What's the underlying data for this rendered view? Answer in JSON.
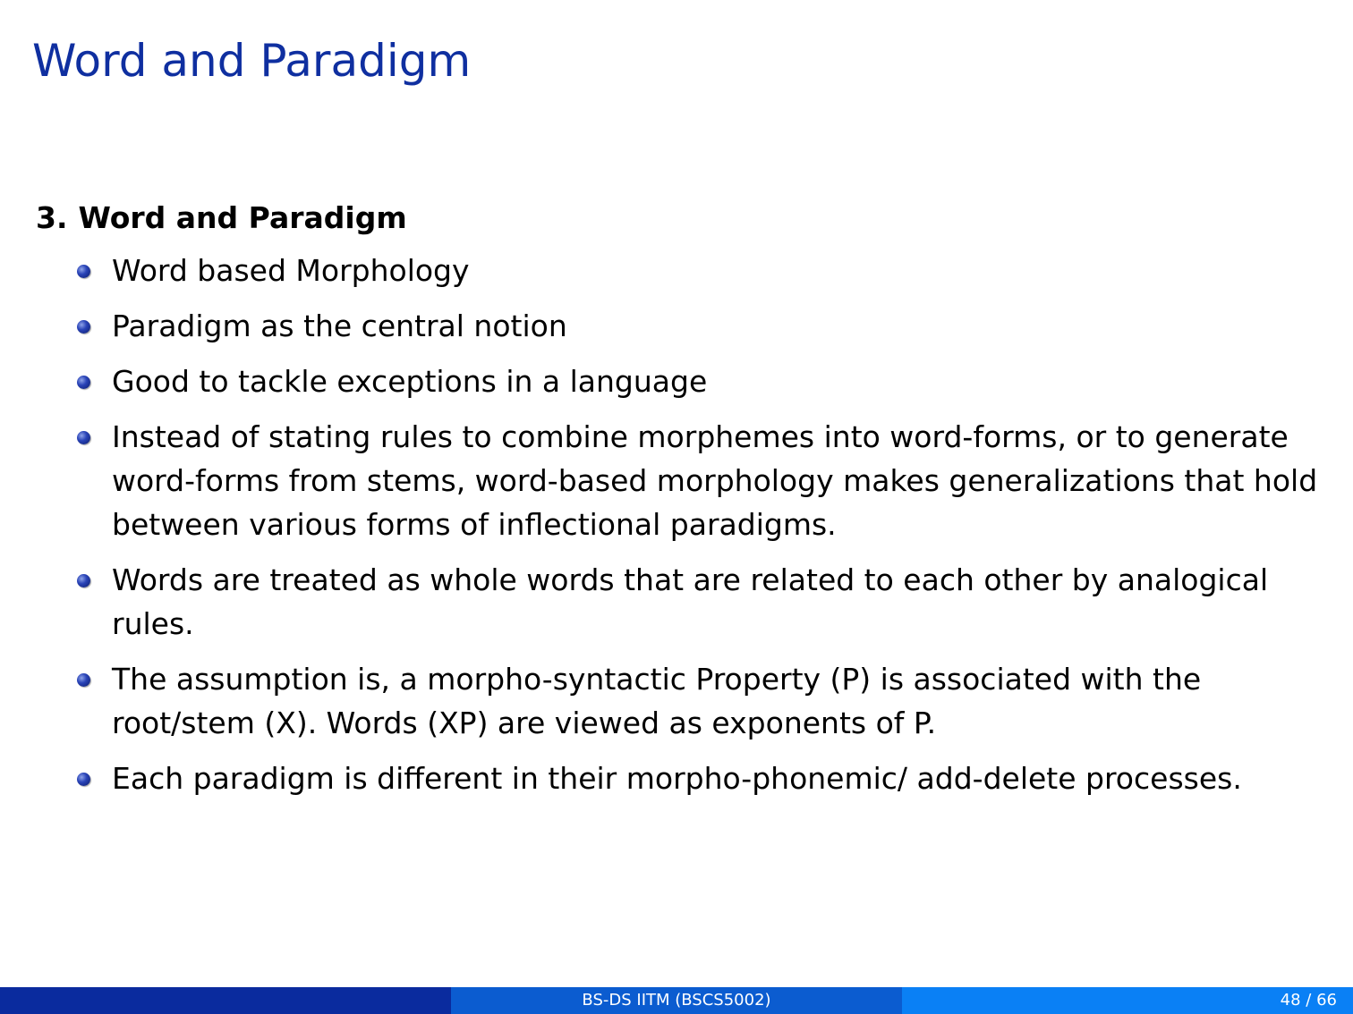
{
  "slide": {
    "title": "Word and Paradigm"
  },
  "section": {
    "number": "3.",
    "heading": "Word and Paradigm",
    "bullets": [
      "Word based Morphology",
      "Paradigm as the central notion",
      "Good to tackle exceptions in a language",
      "Instead of stating rules to combine morphemes into word-forms, or to generate word-forms from stems, word-based morphology makes generalizations that hold between various forms of inflectional paradigms.",
      "Words are treated as whole words that are related to each other by analogical rules.",
      "The assumption is, a morpho-syntactic Property (P) is associated with the root/stem (X). Words (XP) are viewed as exponents of P.",
      "Each paradigm is different in their morpho-phonemic/ add-delete processes."
    ]
  },
  "footer": {
    "course": "BS-DS IITM (BSCS5002)",
    "page": "48 / 66"
  },
  "colors": {
    "title": "#0f2fa0",
    "footer_left": "#0a2b9e",
    "footer_mid": "#0b5cd0",
    "footer_right": "#0a80f5"
  }
}
